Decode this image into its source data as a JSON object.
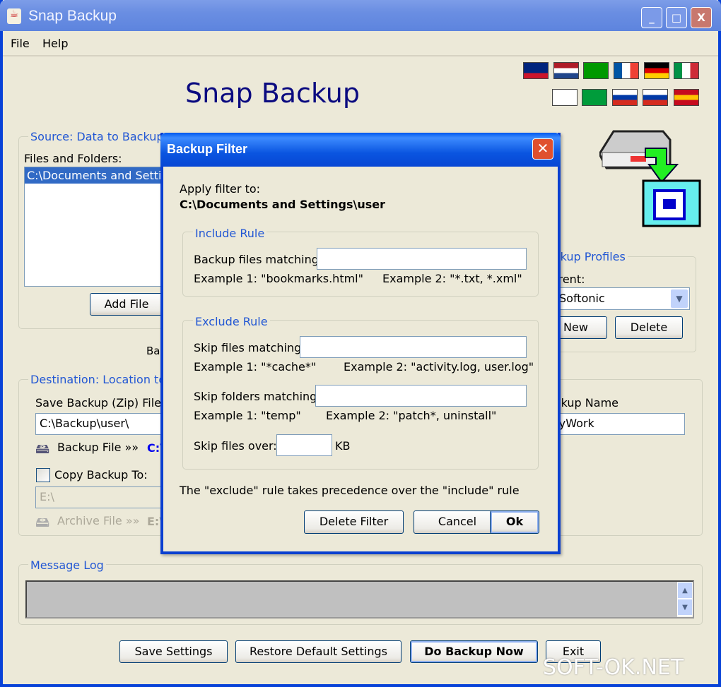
{
  "window": {
    "title": "Snap Backup",
    "minimize": "_",
    "maximize": "□",
    "close": "X"
  },
  "menu": [
    "File",
    "Help"
  ],
  "app_title": "Snap Backup",
  "flags": [
    {
      "name": "new-zealand",
      "colors": [
        "#00247d",
        "#00247d",
        "#cc142b"
      ]
    },
    {
      "name": "netherlands",
      "colors": [
        "#ae1c28",
        "#ffffff",
        "#21468b"
      ]
    },
    {
      "name": "esperanto",
      "colors": [
        "#009900",
        "#009900",
        "#009900"
      ]
    },
    {
      "name": "france",
      "colors": [
        "#0055a4",
        "#ffffff",
        "#ef4135"
      ],
      "vertical": true
    },
    {
      "name": "germany",
      "colors": [
        "#000000",
        "#dd0000",
        "#ffce00"
      ]
    },
    {
      "name": "italy",
      "colors": [
        "#009246",
        "#ffffff",
        "#ce2b37"
      ],
      "vertical": true
    },
    {
      "name": "korea",
      "colors": [
        "#ffffff",
        "#ffffff",
        "#ffffff"
      ]
    },
    {
      "name": "brazil",
      "colors": [
        "#009c3b",
        "#009c3b",
        "#009c3b"
      ]
    },
    {
      "name": "russia",
      "colors": [
        "#ffffff",
        "#0039a6",
        "#d52b1e"
      ]
    },
    {
      "name": "slovenia",
      "colors": [
        "#ffffff",
        "#0039a6",
        "#d52b1e"
      ]
    },
    {
      "name": "spain",
      "colors": [
        "#c60b1e",
        "#ffc400",
        "#c60b1e"
      ]
    }
  ],
  "source": {
    "label": "Source: Data to Backup",
    "files_label": "Files and Folders:",
    "files": [
      "C:\\Documents and Settings\\user"
    ],
    "add_file": "Add File",
    "partial_text": "Ba"
  },
  "profiles": {
    "label": "Backup Profiles",
    "current_label": "Current:",
    "current": "Softonic",
    "new": "New",
    "delete": "Delete"
  },
  "destination": {
    "label": "Destination: Location to",
    "save_label": "Save Backup (Zip) File In:",
    "save_path": "C:\\Backup\\user\\",
    "backup_file": "Backup File »»",
    "backup_file_path": "C:\\",
    "copy_label": "Copy Backup To:",
    "copy_path": "E:\\",
    "archive_file": "Archive File »»",
    "archive_path": "E:\\",
    "name_label": "Backup Name:",
    "name_value": "MyWork"
  },
  "message_log": {
    "label": "Message Log",
    "content": ""
  },
  "bottom": {
    "save": "Save Settings",
    "restore": "Restore Default Settings",
    "do_backup": "Do Backup Now",
    "exit": "Exit"
  },
  "dialog": {
    "title": "Backup Filter",
    "apply_label": "Apply filter to:",
    "apply_path": "C:\\Documents and Settings\\user",
    "include": {
      "label": "Include Rule",
      "match_label": "Backup files matching:",
      "match_value": "",
      "ex1": "Example 1: \"bookmarks.html\"",
      "ex2": "Example 2: \"*.txt, *.xml\""
    },
    "exclude": {
      "label": "Exclude Rule",
      "files_label": "Skip files matching:",
      "files_value": "",
      "files_ex1": "Example 1: \"*cache*\"",
      "files_ex2": "Example 2: \"activity.log, user.log\"",
      "folders_label": "Skip folders matching:",
      "folders_value": "",
      "folders_ex1": "Example 1: \"temp\"",
      "folders_ex2": "Example 2: \"patch*, uninstall\"",
      "size_label": "Skip files over:",
      "size_value": "",
      "size_unit": "KB"
    },
    "note": "The \"exclude\" rule takes precedence over the \"include\" rule",
    "delete_filter": "Delete Filter",
    "cancel": "Cancel",
    "ok": "Ok"
  },
  "watermark": "SOFT-OK.NET"
}
